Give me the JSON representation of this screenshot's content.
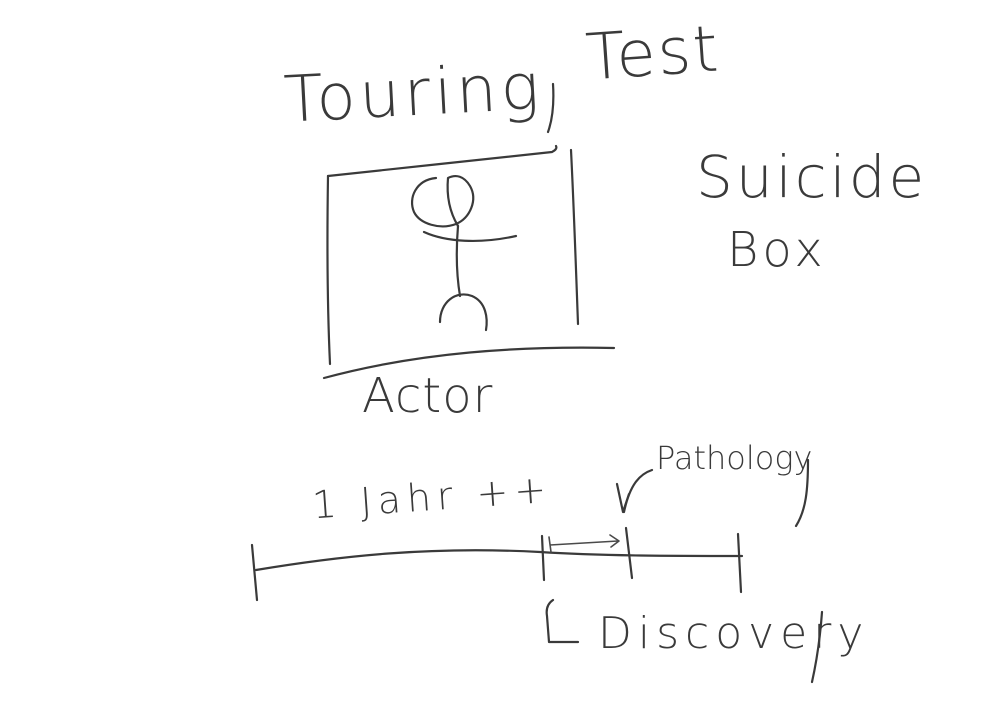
{
  "title": {
    "part1": "Touring",
    "part2": "Test"
  },
  "box_label": {
    "line1": "Suicide",
    "line2": "Box"
  },
  "figure_label": "Actor",
  "timeline": {
    "duration_label": "1 Jahr ++",
    "pathology_label": "Pathology",
    "discovery_label": "Discovery"
  }
}
